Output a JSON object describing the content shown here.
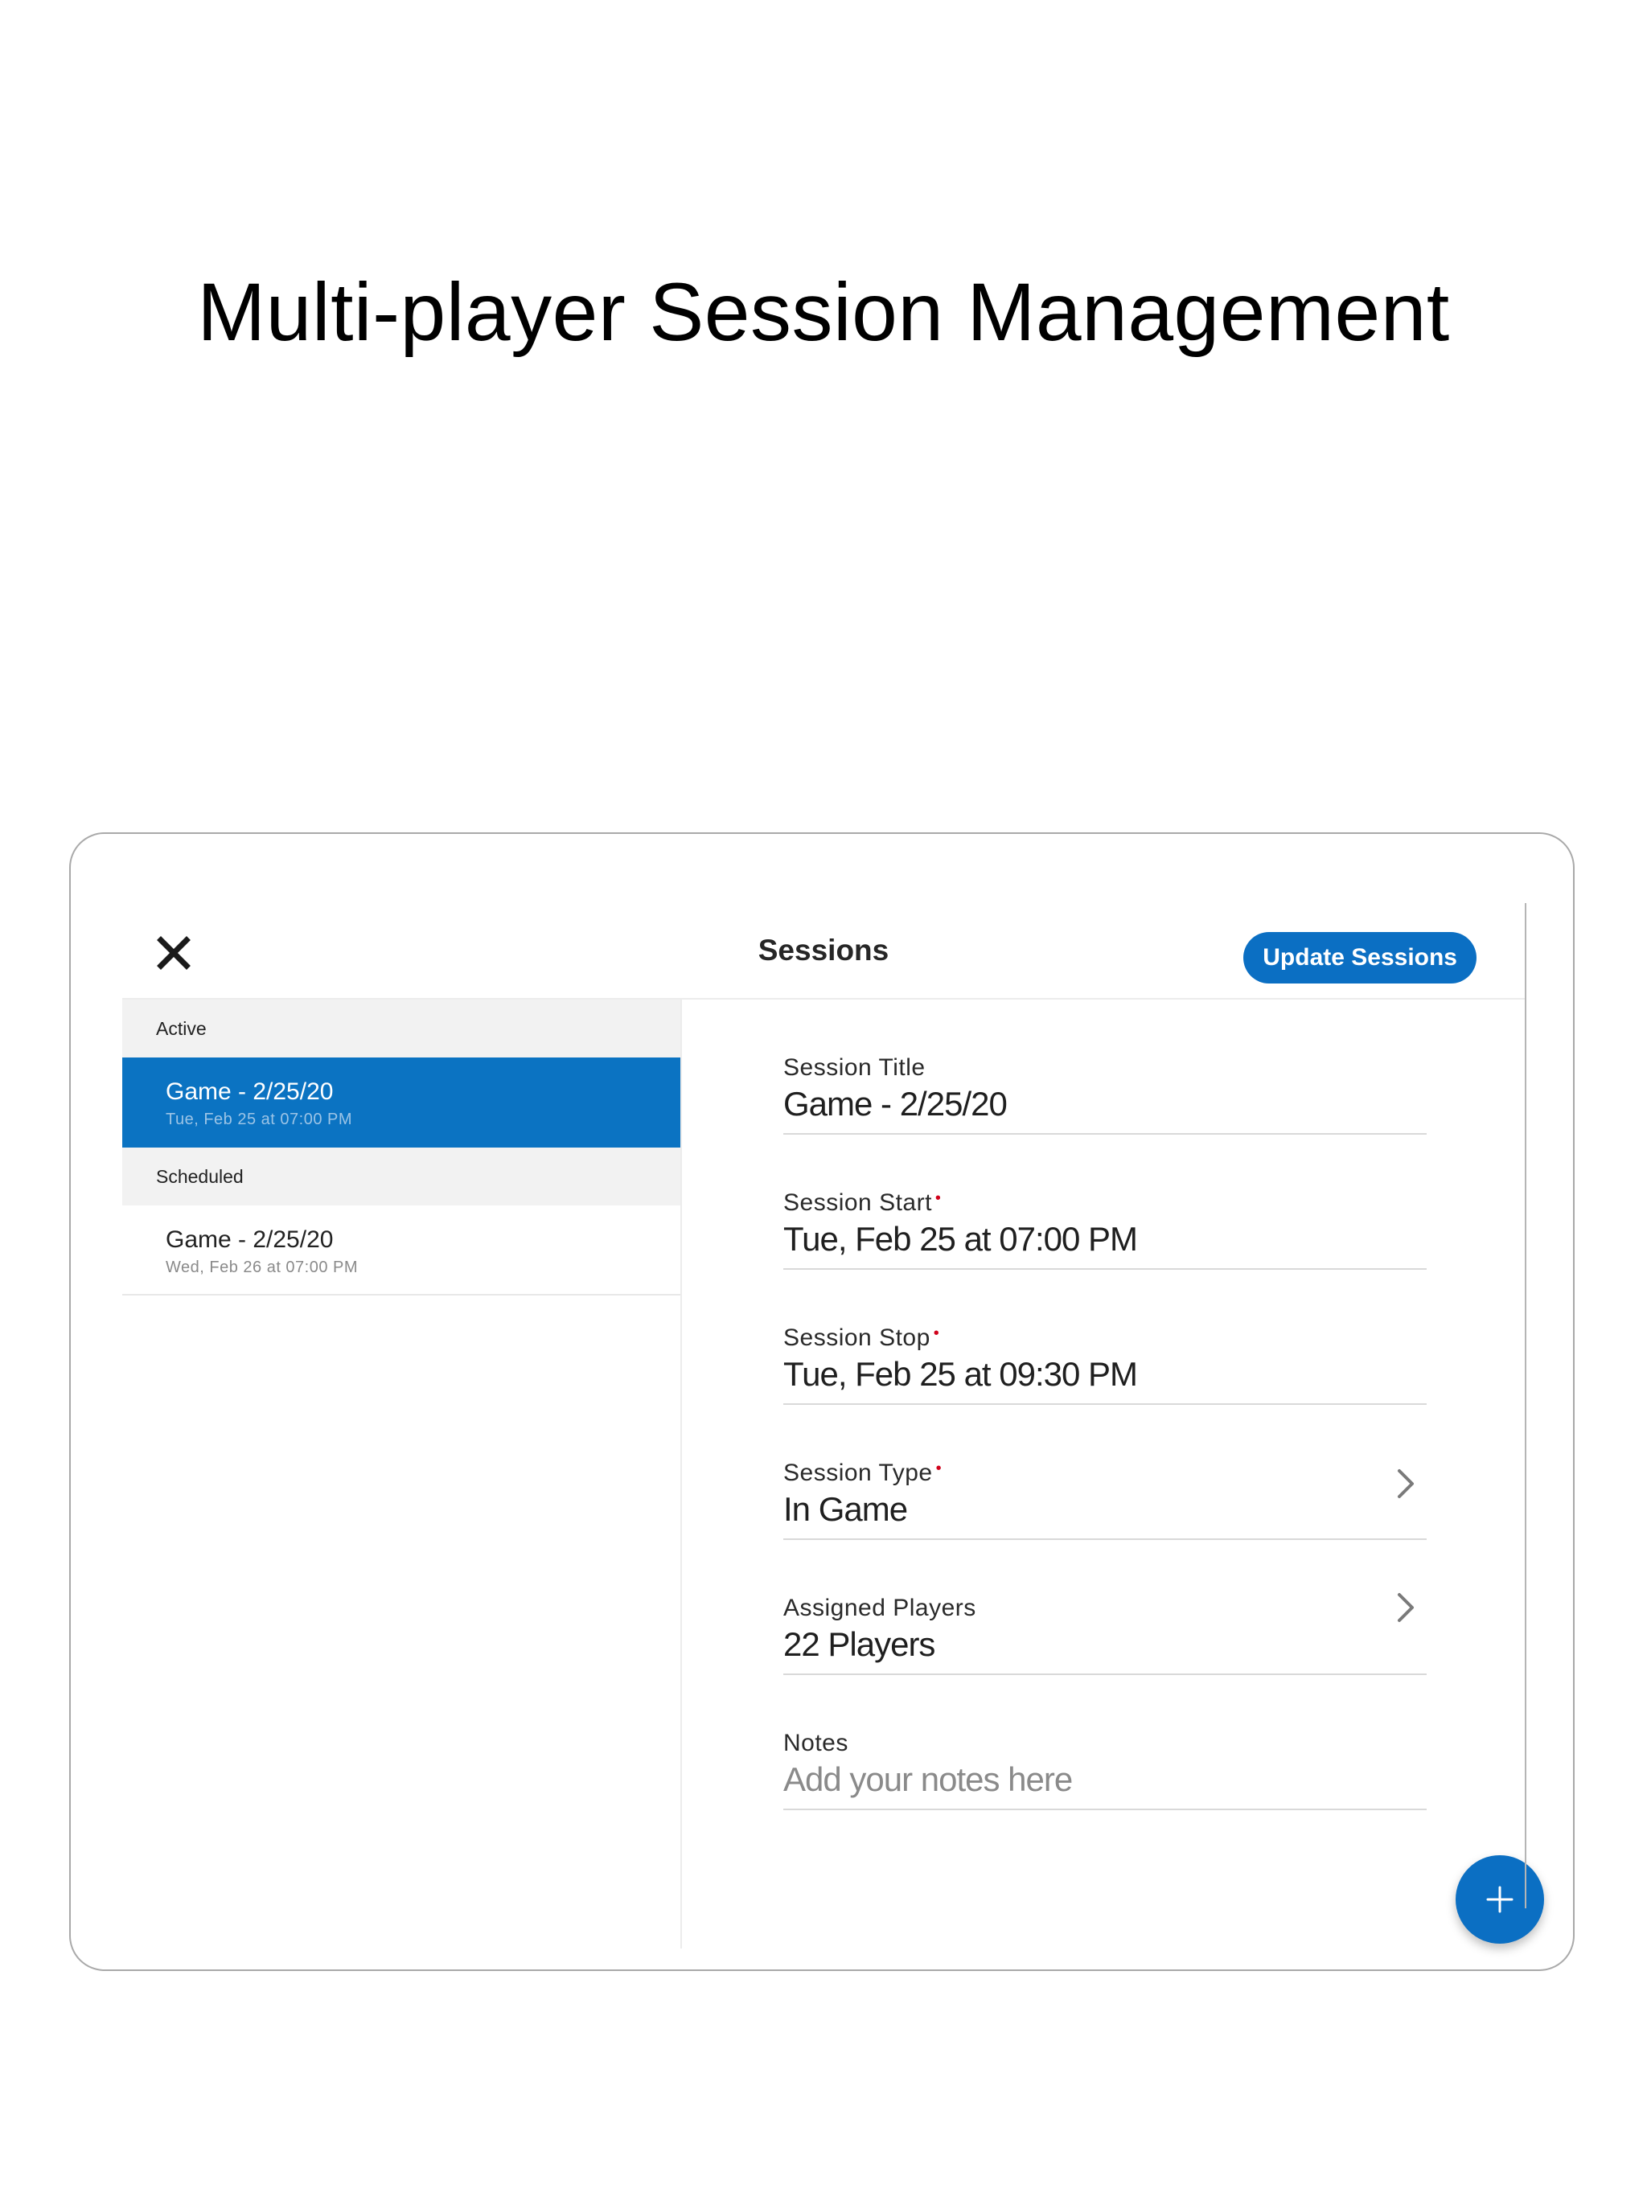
{
  "headline": "Multi-player Session Management",
  "navbar": {
    "title": "Sessions",
    "update_label": "Update Sessions",
    "close_icon": "close-icon"
  },
  "list": {
    "sections": [
      {
        "header": "Active",
        "items": [
          {
            "title": "Game - 2/25/20",
            "subtitle": "Tue, Feb 25 at 07:00 PM",
            "selected": true
          }
        ]
      },
      {
        "header": "Scheduled",
        "items": [
          {
            "title": "Game - 2/25/20",
            "subtitle": "Wed, Feb 26 at 07:00 PM",
            "selected": false
          }
        ]
      }
    ]
  },
  "detail": {
    "fields": [
      {
        "label": "Session Title",
        "value": "Game - 2/25/20",
        "required": false
      },
      {
        "label": "Session Start",
        "value": "Tue, Feb 25 at 07:00 PM",
        "required": true
      },
      {
        "label": "Session Stop",
        "value": "Tue, Feb 25 at 09:30 PM",
        "required": true
      },
      {
        "label": "Session Type",
        "value": "In Game",
        "required": true
      },
      {
        "label": "Assigned Players",
        "value": "22 Players",
        "required": false
      },
      {
        "label": "Notes",
        "placeholder": "Add your notes here",
        "required": false
      }
    ]
  },
  "colors": {
    "accent": "#0b6fc3",
    "required": "#d0021b"
  },
  "fab_icon": "plus-icon"
}
